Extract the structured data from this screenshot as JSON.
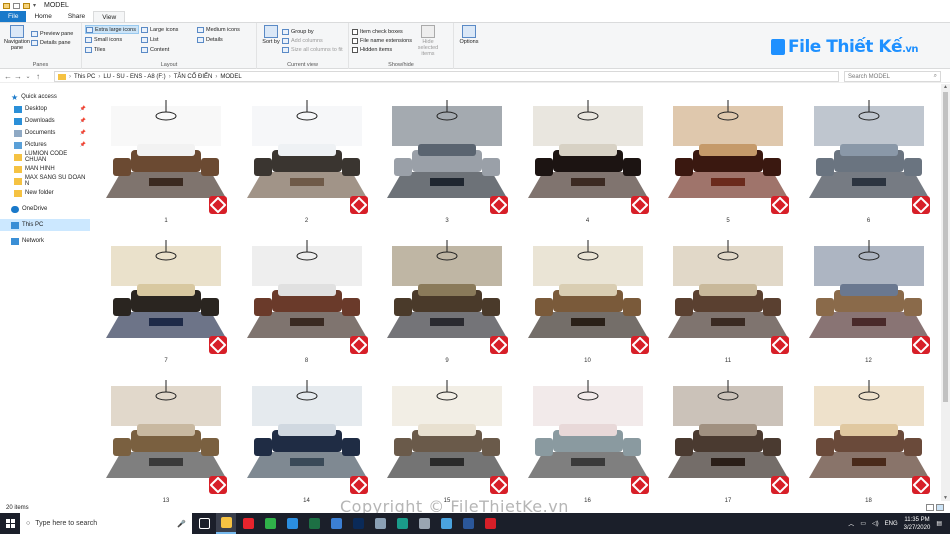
{
  "window": {
    "title": "MODEL"
  },
  "tabs": [
    {
      "label": "File"
    },
    {
      "label": "Home"
    },
    {
      "label": "Share"
    },
    {
      "label": "View"
    }
  ],
  "ribbon": {
    "panes": {
      "navigation_pane": "Navigation pane",
      "preview_pane": "Preview pane",
      "details_pane": "Details pane",
      "group_label": "Panes"
    },
    "layout": {
      "items": [
        "Extra large icons",
        "Large icons",
        "Medium icons",
        "Small icons",
        "List",
        "Details",
        "Tiles",
        "Content"
      ],
      "selected": "Extra large icons",
      "group_label": "Layout"
    },
    "current_view": {
      "sort_by": "Sort by",
      "group_by": "Group by",
      "add_columns": "Add columns",
      "size_columns": "Size all columns to fit",
      "group_label": "Current view"
    },
    "show_hide": {
      "item_check_boxes": "Item check boxes",
      "file_name_extensions": "File name extensions",
      "hidden_items": "Hidden items",
      "hide_selected": "Hide selected items",
      "group_label": "Show/hide"
    },
    "options": {
      "label": "Options"
    }
  },
  "brand": {
    "logo_text": "File Thiết Kế",
    "logo_suffix": ".vn"
  },
  "address": {
    "path": [
      "This PC",
      "LU - SU - ENS - A8 (F:)",
      "TÂN CỔ ĐIỂN",
      "MODEL"
    ],
    "search_placeholder": "Search MODEL"
  },
  "sidebar": {
    "quick_access": "Quick access",
    "items": [
      {
        "label": "Desktop",
        "icon": "desktop-icon",
        "pinned": true
      },
      {
        "label": "Downloads",
        "icon": "download-icon",
        "pinned": true
      },
      {
        "label": "Documents",
        "icon": "document-icon",
        "pinned": true
      },
      {
        "label": "Pictures",
        "icon": "picture-icon",
        "pinned": true
      },
      {
        "label": "LUMION CODE CHUAN",
        "icon": "folder-icon",
        "pinned": false
      },
      {
        "label": "MAN HINH",
        "icon": "folder-icon",
        "pinned": false
      },
      {
        "label": "MAX SANG SU DOAN N",
        "icon": "folder-icon",
        "pinned": false
      },
      {
        "label": "New folder",
        "icon": "folder-icon",
        "pinned": false
      }
    ],
    "onedrive": "OneDrive",
    "this_pc": "This PC",
    "network": "Network"
  },
  "files": [
    "1",
    "2",
    "3",
    "4",
    "5",
    "6",
    "7",
    "8",
    "9",
    "10",
    "11",
    "12",
    "13",
    "14",
    "15",
    "16",
    "17",
    "18"
  ],
  "status": {
    "count": "20 items"
  },
  "watermark": "Copyright © FileThietKe.vn",
  "taskbar": {
    "search_placeholder": "Type here to search",
    "apps": [
      {
        "name": "task-view",
        "color": "#ffffff"
      },
      {
        "name": "file-explorer",
        "color": "#f5c242"
      },
      {
        "name": "opera",
        "color": "#e8242d"
      },
      {
        "name": "app-green",
        "color": "#30b24a"
      },
      {
        "name": "app-blue-circle",
        "color": "#2b8ee0"
      },
      {
        "name": "excel",
        "color": "#1d7044"
      },
      {
        "name": "app-blue",
        "color": "#3b7fd4"
      },
      {
        "name": "photoshop",
        "color": "#0a2a58"
      },
      {
        "name": "app-gray",
        "color": "#8aa0b5"
      },
      {
        "name": "app-teal",
        "color": "#1a9c8a"
      },
      {
        "name": "app-settings",
        "color": "#9aa5b1"
      },
      {
        "name": "app-photos",
        "color": "#4aa3df"
      },
      {
        "name": "word",
        "color": "#2b579a"
      },
      {
        "name": "sketchup",
        "color": "#d71f28"
      }
    ],
    "lang": "ENG",
    "time": "11:35 PM",
    "date": "3/27/2020"
  }
}
